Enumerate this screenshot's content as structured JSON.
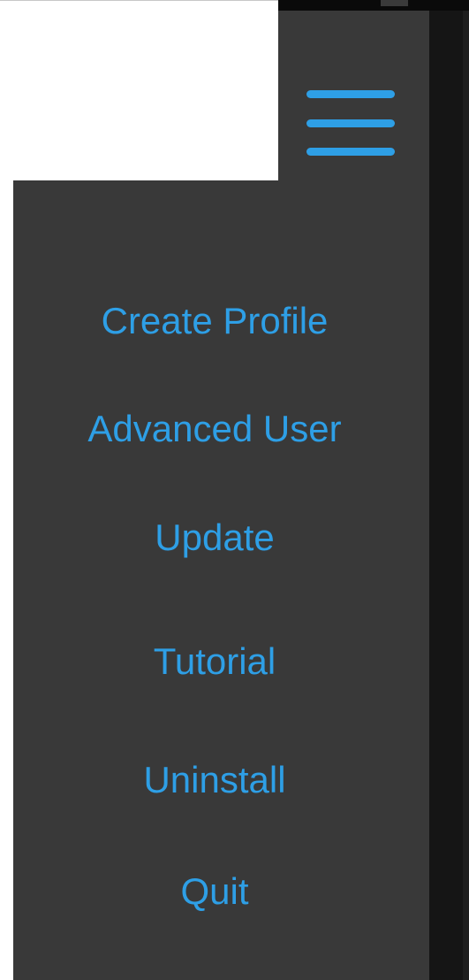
{
  "colors": {
    "accent": "#2e9fe6",
    "panel_background": "#393939",
    "gutter_background": "#151515"
  },
  "header": {
    "logo": "blank-logo",
    "menu_icon": "hamburger-menu-icon"
  },
  "menu": {
    "items": [
      {
        "label": "Create Profile"
      },
      {
        "label": "Advanced User"
      },
      {
        "label": "Update"
      },
      {
        "label": "Tutorial"
      },
      {
        "label": "Uninstall"
      },
      {
        "label": "Quit"
      }
    ]
  }
}
